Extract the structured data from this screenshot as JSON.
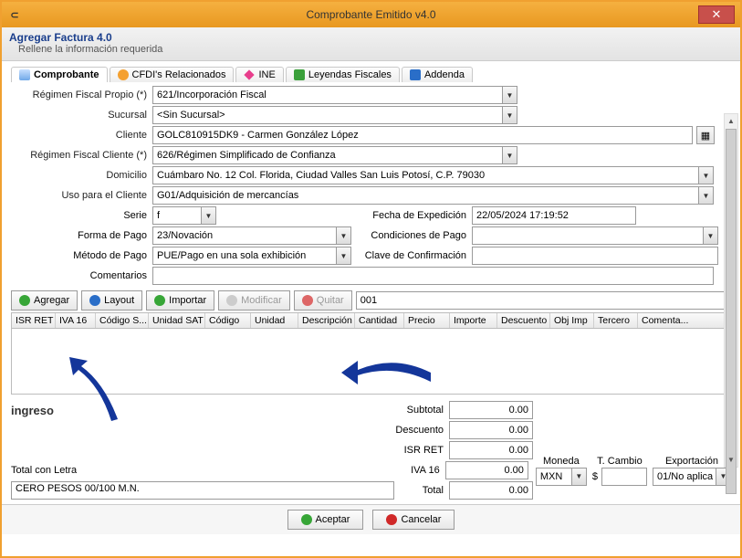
{
  "window": {
    "title": "Comprobante Emitido v4.0"
  },
  "header": {
    "title": "Agregar Factura 4.0",
    "subtitle": "Rellene la información requerida"
  },
  "tabs": [
    {
      "id": "comprobante",
      "label": "Comprobante",
      "active": true
    },
    {
      "id": "cfdis",
      "label": "CFDI's Relacionados",
      "active": false
    },
    {
      "id": "ine",
      "label": "INE",
      "active": false
    },
    {
      "id": "leyendas",
      "label": "Leyendas Fiscales",
      "active": false
    },
    {
      "id": "addenda",
      "label": "Addenda",
      "active": false
    }
  ],
  "form": {
    "regimen_propio_label": "Régimen Fiscal Propio (*)",
    "regimen_propio": "621/Incorporación Fiscal",
    "sucursal_label": "Sucursal",
    "sucursal": "<Sin Sucursal>",
    "cliente_label": "Cliente",
    "cliente": "GOLC810915DK9 - Carmen González López",
    "regimen_cliente_label": "Régimen Fiscal Cliente (*)",
    "regimen_cliente": "626/Régimen Simplificado de Confianza",
    "domicilio_label": "Domicilio",
    "domicilio": "Cuámbaro No. 12 Col. Florida, Ciudad Valles San Luis Potosí, C.P. 79030",
    "uso_label": "Uso para el Cliente",
    "uso": "G01/Adquisición de mercancías",
    "serie_label": "Serie",
    "serie": "f",
    "fecha_exp_label": "Fecha de Expedición",
    "fecha_exp": "22/05/2024 17:19:52",
    "forma_pago_label": "Forma de Pago",
    "forma_pago": "23/Novación",
    "cond_pago_label": "Condiciones de Pago",
    "cond_pago": "",
    "metodo_pago_label": "Método de Pago",
    "metodo_pago": "PUE/Pago en una sola exhibición",
    "clave_conf_label": "Clave de Confirmación",
    "clave_conf": "",
    "comentarios_label": "Comentarios",
    "comentarios": ""
  },
  "toolbar": {
    "agregar": "Agregar",
    "layout": "Layout",
    "importar": "Importar",
    "modificar": "Modificar",
    "quitar": "Quitar",
    "search_value": "001"
  },
  "grid_columns": [
    "ISR RET",
    "IVA 16",
    "Código S...",
    "Unidad SAT",
    "Código",
    "Unidad",
    "Descripción",
    "Cantidad",
    "Precio",
    "Importe",
    "Descuento",
    "Obj Imp",
    "Tercero",
    "Comenta..."
  ],
  "ingreso_label": "ingreso",
  "totals": {
    "subtotal_label": "Subtotal",
    "subtotal": "0.00",
    "descuento_label": "Descuento",
    "descuento": "0.00",
    "isr_label": "ISR RET",
    "isr": "0.00",
    "iva_label": "IVA 16",
    "iva": "0.00",
    "total_label": "Total",
    "total": "0.00"
  },
  "total_letra_label": "Total con Letra",
  "total_letra": "CERO PESOS 00/100 M.N.",
  "extras": {
    "moneda_label": "Moneda",
    "moneda": "MXN",
    "tcambio_label": "T. Cambio",
    "tcambio_prefix": "$",
    "tcambio": "",
    "export_label": "Exportación",
    "export": "01/No aplica"
  },
  "footer": {
    "aceptar": "Aceptar",
    "cancelar": "Cancelar"
  }
}
